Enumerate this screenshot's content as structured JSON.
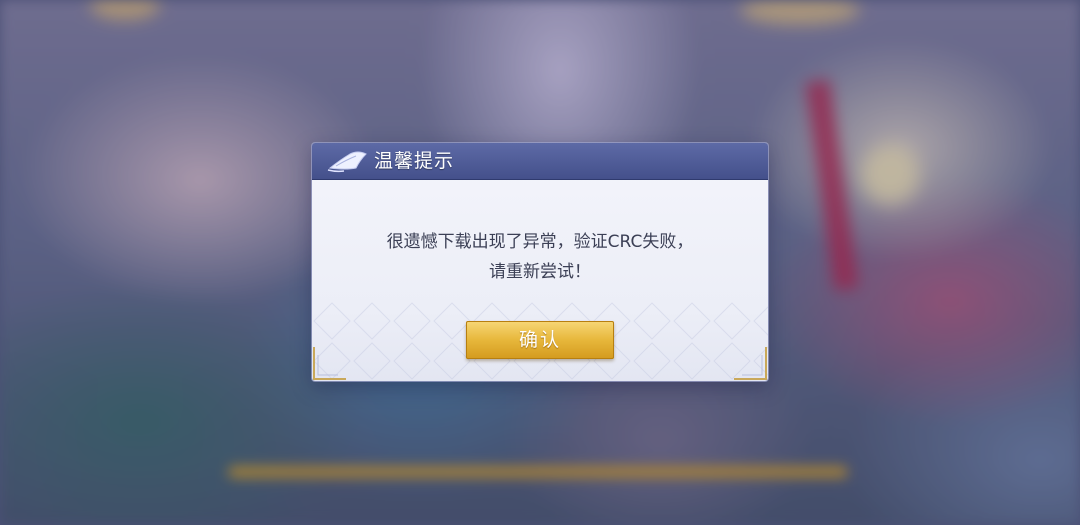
{
  "dialog": {
    "title": "温馨提示",
    "message_line1": "很遗憾下载出现了异常，验证CRC失败，",
    "message_line2": "请重新尝试！",
    "confirm_label": "确认",
    "header_icon": "scroll-icon"
  },
  "colors": {
    "header": "#4a5692",
    "button": "#e7b73b",
    "message_text": "#3b3f55"
  }
}
